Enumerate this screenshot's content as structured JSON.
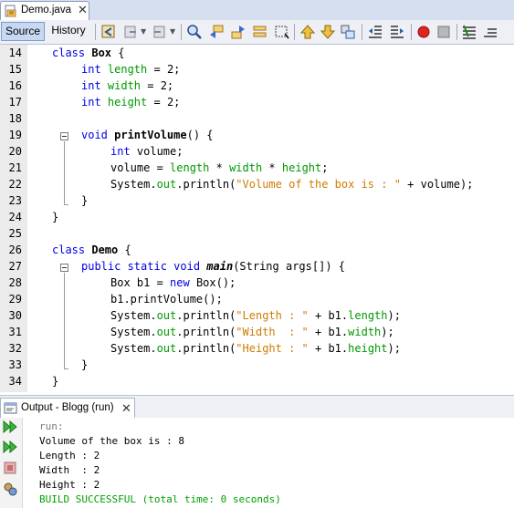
{
  "file_tab": {
    "label": "Demo.java",
    "close": "✕"
  },
  "toolbar": {
    "source_label": "Source",
    "history_label": "History"
  },
  "lines": [
    {
      "num": "14",
      "indent": 0,
      "tokens": [
        {
          "t": "class ",
          "c": "kw"
        },
        {
          "t": "Box",
          "c": "bold"
        },
        {
          "t": " {",
          "c": ""
        }
      ]
    },
    {
      "num": "15",
      "indent": 1,
      "tokens": [
        {
          "t": "int ",
          "c": "kw"
        },
        {
          "t": "length",
          "c": "fld"
        },
        {
          "t": " = 2;",
          "c": ""
        }
      ]
    },
    {
      "num": "16",
      "indent": 1,
      "tokens": [
        {
          "t": "int ",
          "c": "kw"
        },
        {
          "t": "width",
          "c": "fld"
        },
        {
          "t": " = 2;",
          "c": ""
        }
      ]
    },
    {
      "num": "17",
      "indent": 1,
      "tokens": [
        {
          "t": "int ",
          "c": "kw"
        },
        {
          "t": "height",
          "c": "fld"
        },
        {
          "t": " = 2;",
          "c": ""
        }
      ]
    },
    {
      "num": "18",
      "indent": 0,
      "tokens": []
    },
    {
      "num": "19",
      "indent": 1,
      "tokens": [
        {
          "t": "void ",
          "c": "kw"
        },
        {
          "t": "printVolume",
          "c": "bold"
        },
        {
          "t": "() {",
          "c": ""
        }
      ]
    },
    {
      "num": "20",
      "indent": 2,
      "tokens": [
        {
          "t": "int ",
          "c": "kw"
        },
        {
          "t": "volume;",
          "c": ""
        }
      ]
    },
    {
      "num": "21",
      "indent": 2,
      "tokens": [
        {
          "t": "volume = ",
          "c": ""
        },
        {
          "t": "length",
          "c": "fld"
        },
        {
          "t": " * ",
          "c": ""
        },
        {
          "t": "width",
          "c": "fld"
        },
        {
          "t": " * ",
          "c": ""
        },
        {
          "t": "height",
          "c": "fld"
        },
        {
          "t": ";",
          "c": ""
        }
      ]
    },
    {
      "num": "22",
      "indent": 2,
      "tokens": [
        {
          "t": "System.",
          "c": ""
        },
        {
          "t": "out",
          "c": "fld"
        },
        {
          "t": ".println(",
          "c": ""
        },
        {
          "t": "\"Volume of the box is : \"",
          "c": "str"
        },
        {
          "t": " + volume);",
          "c": ""
        }
      ]
    },
    {
      "num": "23",
      "indent": 1,
      "tokens": [
        {
          "t": "}",
          "c": ""
        }
      ]
    },
    {
      "num": "24",
      "indent": 0,
      "tokens": [
        {
          "t": "}",
          "c": ""
        }
      ]
    },
    {
      "num": "25",
      "indent": 0,
      "tokens": []
    },
    {
      "num": "26",
      "indent": 0,
      "tokens": [
        {
          "t": "class ",
          "c": "kw"
        },
        {
          "t": "Demo",
          "c": "bold"
        },
        {
          "t": " {",
          "c": ""
        }
      ]
    },
    {
      "num": "27",
      "indent": 1,
      "tokens": [
        {
          "t": "public static void ",
          "c": "kw"
        },
        {
          "t": "main",
          "c": "bi"
        },
        {
          "t": "(String args[]) {",
          "c": ""
        }
      ]
    },
    {
      "num": "28",
      "indent": 2,
      "tokens": [
        {
          "t": "Box b1 = ",
          "c": ""
        },
        {
          "t": "new ",
          "c": "kw"
        },
        {
          "t": "Box();",
          "c": ""
        }
      ]
    },
    {
      "num": "29",
      "indent": 2,
      "tokens": [
        {
          "t": "b1.printVolume();",
          "c": ""
        }
      ]
    },
    {
      "num": "30",
      "indent": 2,
      "tokens": [
        {
          "t": "System.",
          "c": ""
        },
        {
          "t": "out",
          "c": "fld"
        },
        {
          "t": ".println(",
          "c": ""
        },
        {
          "t": "\"Length : \"",
          "c": "str"
        },
        {
          "t": " + b1.",
          "c": ""
        },
        {
          "t": "length",
          "c": "fld"
        },
        {
          "t": ");",
          "c": ""
        }
      ]
    },
    {
      "num": "31",
      "indent": 2,
      "tokens": [
        {
          "t": "System.",
          "c": ""
        },
        {
          "t": "out",
          "c": "fld"
        },
        {
          "t": ".println(",
          "c": ""
        },
        {
          "t": "\"Width  : \"",
          "c": "str"
        },
        {
          "t": " + b1.",
          "c": ""
        },
        {
          "t": "width",
          "c": "fld"
        },
        {
          "t": ");",
          "c": ""
        }
      ]
    },
    {
      "num": "32",
      "indent": 2,
      "tokens": [
        {
          "t": "System.",
          "c": ""
        },
        {
          "t": "out",
          "c": "fld"
        },
        {
          "t": ".println(",
          "c": ""
        },
        {
          "t": "\"Height : \"",
          "c": "str"
        },
        {
          "t": " + b1.",
          "c": ""
        },
        {
          "t": "height",
          "c": "fld"
        },
        {
          "t": ");",
          "c": ""
        }
      ]
    },
    {
      "num": "33",
      "indent": 1,
      "tokens": [
        {
          "t": "}",
          "c": ""
        }
      ]
    },
    {
      "num": "34",
      "indent": 0,
      "tokens": [
        {
          "t": "}",
          "c": ""
        }
      ]
    }
  ],
  "output": {
    "tab_label": "Output - Blogg (run)",
    "close": "✕",
    "lines": [
      {
        "text": "run:",
        "c": "out-run"
      },
      {
        "text": "Volume of the box is : 8",
        "c": ""
      },
      {
        "text": "Length : 2",
        "c": ""
      },
      {
        "text": "Width  : 2",
        "c": ""
      },
      {
        "text": "Height : 2",
        "c": ""
      },
      {
        "text": "BUILD SUCCESSFUL (total time: 0 seconds)",
        "c": "out-success"
      }
    ]
  }
}
